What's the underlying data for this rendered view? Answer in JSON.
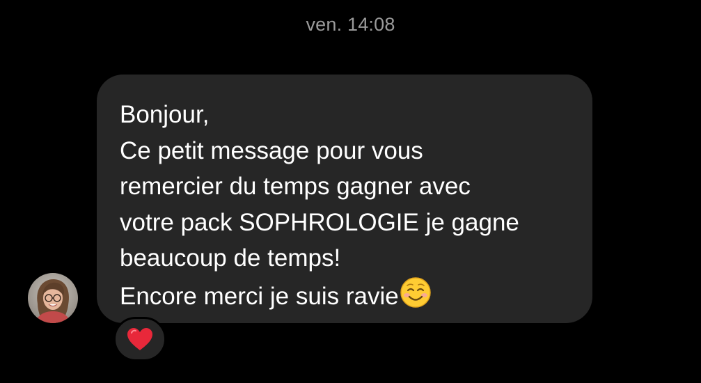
{
  "header": {
    "timestamp": "ven. 14:08"
  },
  "sender": {
    "avatar_icon": "person-photo-avatar"
  },
  "message": {
    "lines": [
      "Bonjour,",
      "Ce petit message pour vous",
      "remercier du temps gagner avec",
      "votre pack SOPHROLOGIE je gagne",
      "beaucoup de temps!",
      "Encore merci je suis ravie"
    ],
    "trailing_emoji": "smiling-face-icon",
    "bubble_color": "#262626",
    "text_color": "#ffffff"
  },
  "reaction": {
    "emoji": "red-heart-icon",
    "color": "#e8283a"
  },
  "colors": {
    "background": "#000000",
    "timestamp": "#9a9a9a"
  }
}
